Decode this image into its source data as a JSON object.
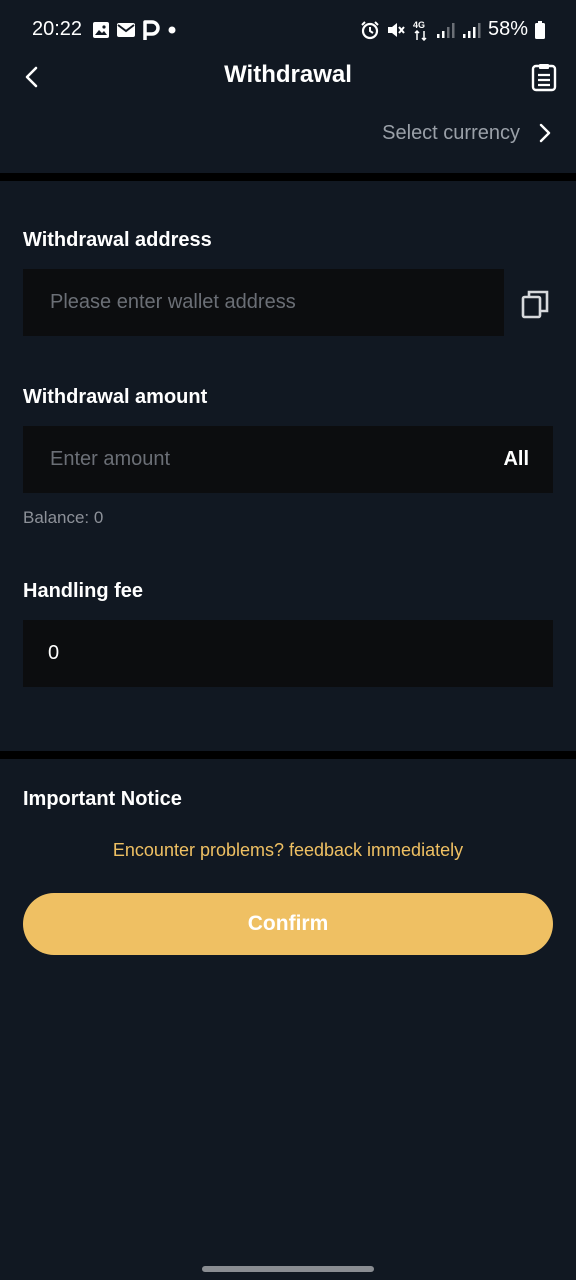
{
  "status_bar": {
    "time": "20:22",
    "network": "4G",
    "battery": "58%"
  },
  "header": {
    "title": "Withdrawal",
    "back_icon": "chevron-left-icon",
    "records_icon": "clipboard-list-icon"
  },
  "currency": {
    "label": "Select currency",
    "icon": "chevron-right-icon"
  },
  "address": {
    "label": "Withdrawal address",
    "placeholder": "Please enter wallet address",
    "value": "",
    "paste_icon": "copy-icon"
  },
  "amount": {
    "label": "Withdrawal amount",
    "placeholder": "Enter amount",
    "value": "",
    "all_label": "All",
    "balance": "Balance: 0"
  },
  "fee": {
    "label": "Handling fee",
    "value": "0"
  },
  "notice": {
    "title": "Important Notice",
    "feedback_link": "Encounter problems? feedback immediately"
  },
  "confirm_label": "Confirm",
  "colors": {
    "background": "#111822",
    "field": "#0c0d0f",
    "accent": "#efc063",
    "muted": "#9aa0a8"
  }
}
